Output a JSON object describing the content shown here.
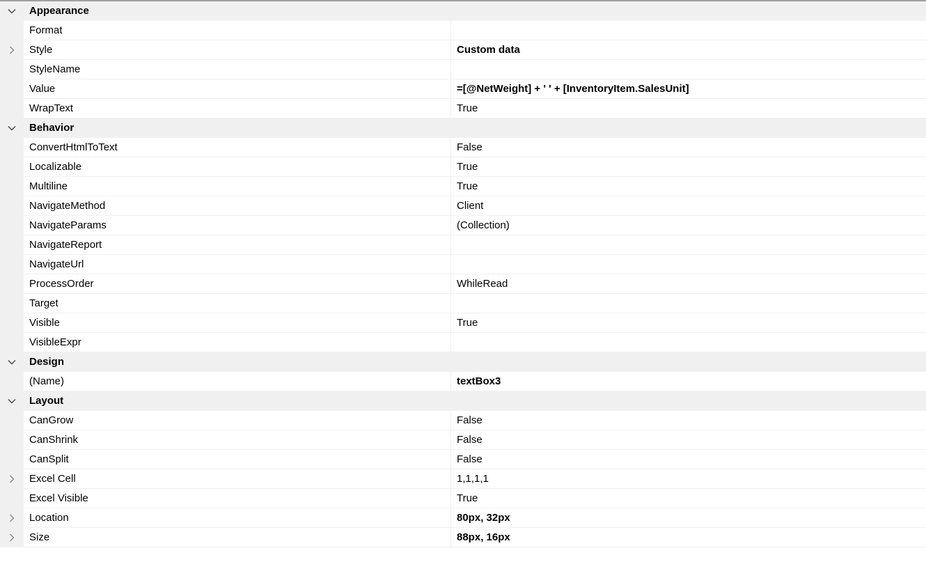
{
  "categories": [
    {
      "title": "Appearance",
      "expanded": true,
      "icon": "chevron-down-icon",
      "properties": [
        {
          "name": "Format",
          "value": "",
          "bold": false,
          "expandable": false
        },
        {
          "name": "Style",
          "value": "Custom data",
          "bold": true,
          "expandable": true
        },
        {
          "name": "StyleName",
          "value": "",
          "bold": false,
          "expandable": false
        },
        {
          "name": "Value",
          "value": "=[@NetWeight] + ' ' + [InventoryItem.SalesUnit]",
          "bold": true,
          "expandable": false
        },
        {
          "name": "WrapText",
          "value": "True",
          "bold": false,
          "expandable": false
        }
      ]
    },
    {
      "title": "Behavior",
      "expanded": true,
      "icon": "chevron-down-icon",
      "properties": [
        {
          "name": "ConvertHtmlToText",
          "value": "False",
          "bold": false,
          "expandable": false
        },
        {
          "name": "Localizable",
          "value": "True",
          "bold": false,
          "expandable": false
        },
        {
          "name": "Multiline",
          "value": "True",
          "bold": false,
          "expandable": false
        },
        {
          "name": "NavigateMethod",
          "value": "Client",
          "bold": false,
          "expandable": false
        },
        {
          "name": "NavigateParams",
          "value": "(Collection)",
          "bold": false,
          "expandable": false
        },
        {
          "name": "NavigateReport",
          "value": "",
          "bold": false,
          "expandable": false
        },
        {
          "name": "NavigateUrl",
          "value": "",
          "bold": false,
          "expandable": false
        },
        {
          "name": "ProcessOrder",
          "value": "WhileRead",
          "bold": false,
          "expandable": false
        },
        {
          "name": "Target",
          "value": "",
          "bold": false,
          "expandable": false
        },
        {
          "name": "Visible",
          "value": "True",
          "bold": false,
          "expandable": false
        },
        {
          "name": "VisibleExpr",
          "value": "",
          "bold": false,
          "expandable": false
        }
      ]
    },
    {
      "title": "Design",
      "expanded": true,
      "icon": "chevron-down-icon",
      "properties": [
        {
          "name": "(Name)",
          "value": "textBox3",
          "bold": true,
          "expandable": false
        }
      ]
    },
    {
      "title": "Layout",
      "expanded": true,
      "icon": "chevron-down-icon",
      "properties": [
        {
          "name": "CanGrow",
          "value": "False",
          "bold": false,
          "expandable": false
        },
        {
          "name": "CanShrink",
          "value": "False",
          "bold": false,
          "expandable": false
        },
        {
          "name": "CanSplit",
          "value": "False",
          "bold": false,
          "expandable": false
        },
        {
          "name": "Excel Cell",
          "value": "1,1,1,1",
          "bold": false,
          "expandable": true
        },
        {
          "name": "Excel Visible",
          "value": "True",
          "bold": false,
          "expandable": false
        },
        {
          "name": "Location",
          "value": "80px, 32px",
          "bold": true,
          "expandable": true
        },
        {
          "name": "Size",
          "value": "88px, 16px",
          "bold": true,
          "expandable": true
        }
      ]
    }
  ],
  "colors": {
    "category_background": "#f0f0f0",
    "gutter_background": "#f0f0f0",
    "grid_line": "#f0f0f0",
    "text": "#000000"
  }
}
